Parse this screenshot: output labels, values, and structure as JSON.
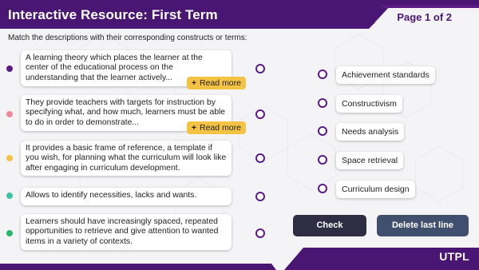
{
  "header": {
    "title": "Interactive Resource: First Term",
    "page_indicator": "Page 1 of 2"
  },
  "instructions": "Match the descriptions with their corresponding constructs or terms:",
  "descriptions": [
    {
      "text": "A learning theory which places the learner at the center of the educational process on the understanding that the learner actively...",
      "read_more": "Read more",
      "dot_color": "#5b1a86"
    },
    {
      "text": "They provide teachers with targets for instruction by specifying what, and how much, learners must be able to do in order to demonstrate...",
      "read_more": "Read more",
      "dot_color": "#ef8a9e"
    },
    {
      "text": "It provides a basic frame of reference, a template if you wish, for planning what the curriculum will look like after engaging in curriculum development.",
      "dot_color": "#f5c343"
    },
    {
      "text": "Allows to identify necessities, lacks and wants.",
      "dot_color": "#3cc3a5"
    },
    {
      "text": "Learners should have increasingly spaced, repeated opportunities to retrieve and give attention to wanted items in a variety of contexts.",
      "dot_color": "#27b66b"
    }
  ],
  "terms": [
    "Achievement standards",
    "Constructivism",
    "Needs analysis",
    "Space retrieval",
    "Curriculum design"
  ],
  "buttons": {
    "check": "Check",
    "delete_last_line": "Delete last line"
  },
  "footer": {
    "logo": "UTPL"
  },
  "colors": {
    "primary": "#4a1673",
    "accent": "#f5c343",
    "check_button": "#2e2d44",
    "delete_button": "#3f4f6d"
  }
}
